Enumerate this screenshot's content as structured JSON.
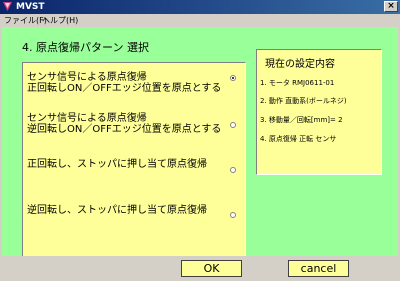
{
  "window": {
    "title": "MVST"
  },
  "menu": {
    "file": "ファイル(F)",
    "help": "ヘルプ(H)"
  },
  "heading": "4. 原点復帰パターン 選択",
  "options": [
    {
      "line1": "センサ信号による原点復帰",
      "line2": "正回転しON／OFFエッジ位置を原点とする",
      "selected": true
    },
    {
      "line1": "センサ信号による原点復帰",
      "line2": "逆回転しON／OFFエッジ位置を原点とする",
      "selected": false
    },
    {
      "line1": "正回転し、ストッパに押し当て原点復帰",
      "line2": "",
      "selected": false
    },
    {
      "line1": "逆回転し、ストッパに押し当て原点復帰",
      "line2": "",
      "selected": false
    }
  ],
  "settings": {
    "title": "現在の設定内容",
    "items": [
      "1. モータ  RMJ0611-01",
      "2. 動作  直動系(ボールネジ)",
      "3. 移動量／回転[mm]= 2",
      "4. 原点復帰 正転 センサ"
    ]
  },
  "buttons": {
    "ok": "OK",
    "cancel": "cancel"
  },
  "colors": {
    "client_bg": "#99ff99",
    "panel_bg": "#ffff99",
    "titlebar": "#0a246a"
  }
}
